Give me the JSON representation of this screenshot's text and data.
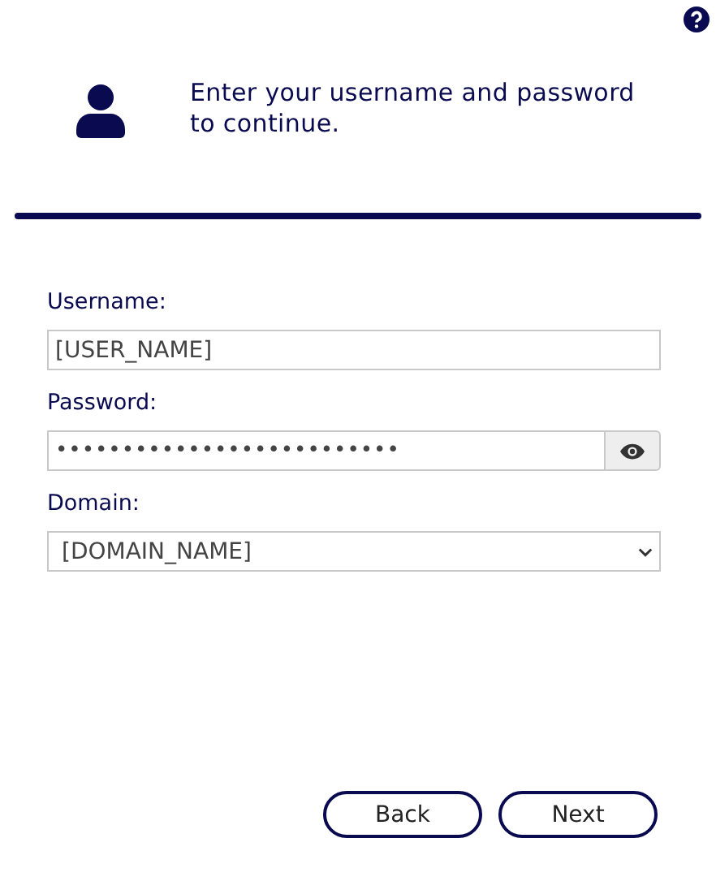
{
  "header": {
    "message": "Enter your username and password to continue."
  },
  "fields": [
    {
      "kind": "text",
      "label": "Username:",
      "value": "[USER_NAME]"
    },
    {
      "kind": "password",
      "label": "Password:",
      "value": "••••••••••••••••••••••••••"
    },
    {
      "kind": "select",
      "label": "Domain:",
      "value": "[DOMAIN_NAME]"
    }
  ],
  "buttons": [
    {
      "label": "Back"
    },
    {
      "label": "Next"
    }
  ]
}
